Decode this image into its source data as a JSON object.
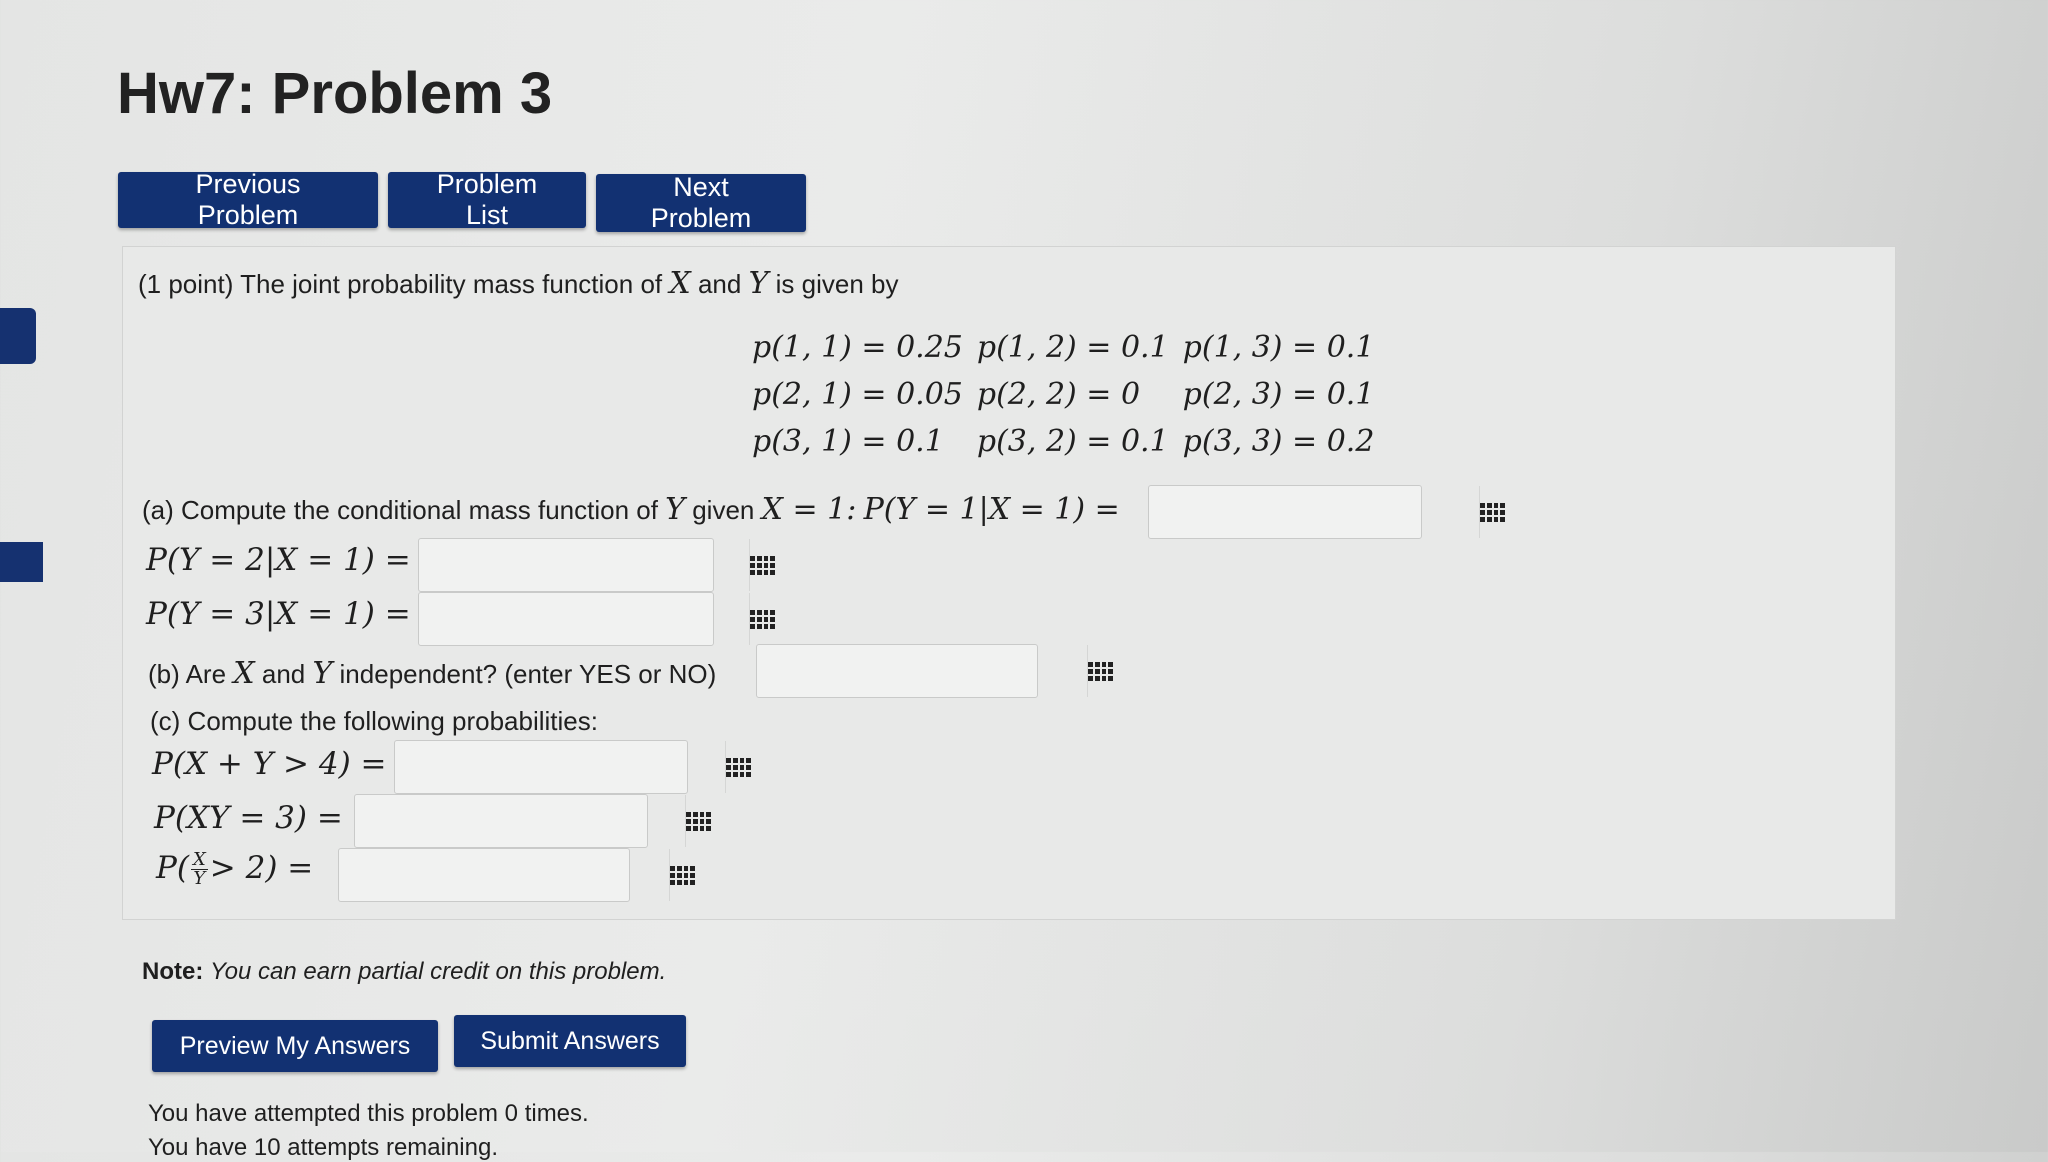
{
  "page": {
    "title": "Hw7: Problem 3"
  },
  "nav": {
    "previous": "Previous Problem",
    "list": "Problem List",
    "next": "Next Problem"
  },
  "problem": {
    "intro_prefix": "(1 point) The joint probability mass function of",
    "var_x": "X",
    "intro_and": "and",
    "var_y": "Y",
    "intro_suffix": "is given by",
    "pmf": [
      [
        "p(1, 1) = 0.25",
        "p(1, 2) = 0.1",
        "p(1, 3) = 0.1"
      ],
      [
        "p(2, 1) = 0.05",
        "p(2, 2) = 0",
        "p(2, 3) = 0.1"
      ],
      [
        "p(3, 1) = 0.1",
        "p(3, 2) = 0.1",
        "p(3, 3) = 0.2"
      ]
    ],
    "part_a_text": "(a) Compute the conditional mass function of",
    "part_a_given": "given",
    "part_a_cond": "X = 1:",
    "part_a_eq1": "P(Y = 1|X = 1) =",
    "part_a_eq2": "P(Y = 2|X = 1) =",
    "part_a_eq3": "P(Y = 3|X = 1) =",
    "part_b_prefix": "(b) Are",
    "part_b_and": "and",
    "part_b_suffix": "independent? (enter YES or NO)",
    "part_c_text": "(c) Compute the following probabilities:",
    "part_c_eq1": "P(X + Y > 4) =",
    "part_c_eq2": "P(XY = 3) =",
    "part_c_eq3_pre": "P(",
    "part_c_eq3_num": "X",
    "part_c_eq3_den": "Y",
    "part_c_eq3_post": "> 2) ="
  },
  "note": {
    "label": "Note:",
    "text": "You can earn partial credit on this problem."
  },
  "actions": {
    "preview": "Preview My Answers",
    "submit": "Submit Answers"
  },
  "status": {
    "attempted": "You have attempted this problem 0 times.",
    "remaining": "You have 10 attempts remaining."
  },
  "icons": {
    "answer_tool": "grid-icon"
  },
  "colors": {
    "button": "#123172",
    "background": "#e6e7e6"
  }
}
